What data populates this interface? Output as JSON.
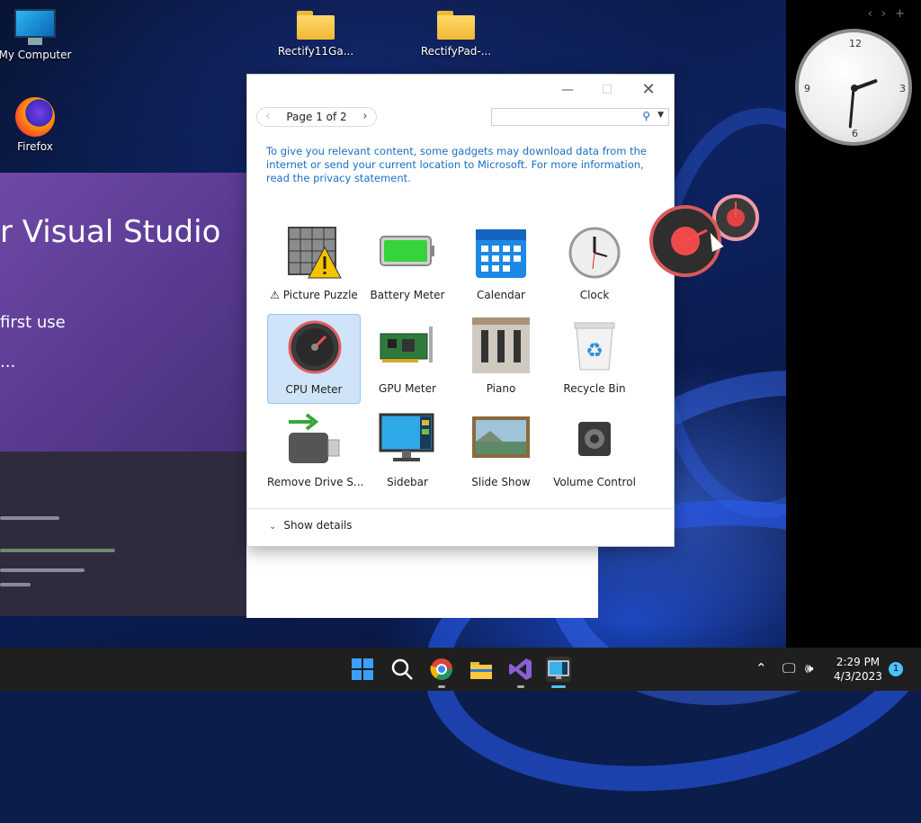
{
  "desktop": {
    "icons": [
      {
        "label": "My Computer"
      },
      {
        "label": "Firefox"
      },
      {
        "label": "Rectify11Ga..."
      },
      {
        "label": "RectifyPad-..."
      }
    ]
  },
  "vs_splash": {
    "title": "r Visual Studio",
    "subtitle": "first use",
    "dots": "..."
  },
  "gallery": {
    "pager_label": "Page 1 of 2",
    "search_placeholder": "",
    "privacy_text": "To give you relevant content, some gadgets may download data from the internet or send your current location to Microsoft. For more information, read the privacy statement.",
    "gadgets": [
      {
        "label": "⚠ Picture Puzzle"
      },
      {
        "label": "Battery Meter"
      },
      {
        "label": "Calendar"
      },
      {
        "label": "Clock"
      },
      {
        "label": "CPU Meter"
      },
      {
        "label": "GPU Meter"
      },
      {
        "label": "Piano"
      },
      {
        "label": "Recycle Bin"
      },
      {
        "label": "Remove Drive S..."
      },
      {
        "label": "Sidebar"
      },
      {
        "label": "Slide Show"
      },
      {
        "label": "Volume Control"
      }
    ],
    "show_details": "Show details"
  },
  "sidebar": {
    "clock_numbers": {
      "n12": "12",
      "n3": "3",
      "n6": "6",
      "n9": "9"
    }
  },
  "taskbar": {
    "time": "2:29 PM",
    "date": "4/3/2023",
    "notifications": "1"
  }
}
